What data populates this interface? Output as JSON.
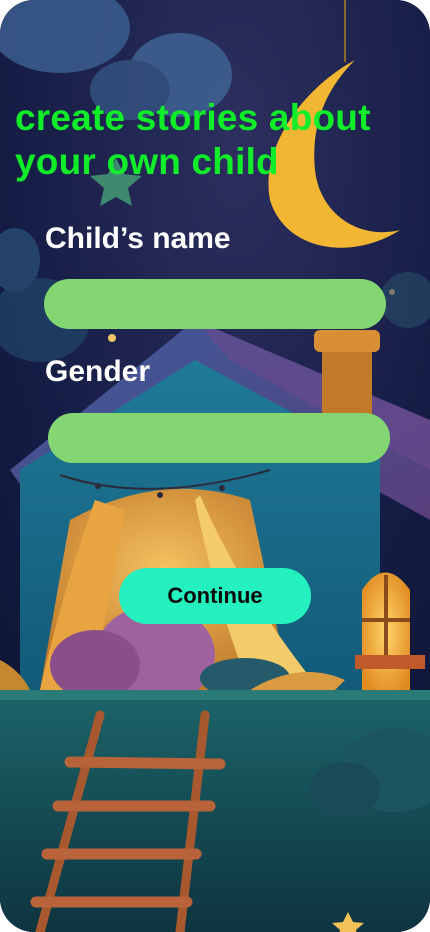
{
  "screen": {
    "headline": "create stories about your own child"
  },
  "form": {
    "child_name_label": "Child’s name",
    "child_name_value": "",
    "gender_label": "Gender",
    "gender_value": "",
    "continue_label": "Continue"
  },
  "colors": {
    "headline": "#10ee2a",
    "input_fill": "#83d672",
    "button_fill": "#24f0c0",
    "night_sky": "#101a3c",
    "moon": "#f2b632"
  },
  "icons": {
    "background": "night-house-illustration"
  }
}
